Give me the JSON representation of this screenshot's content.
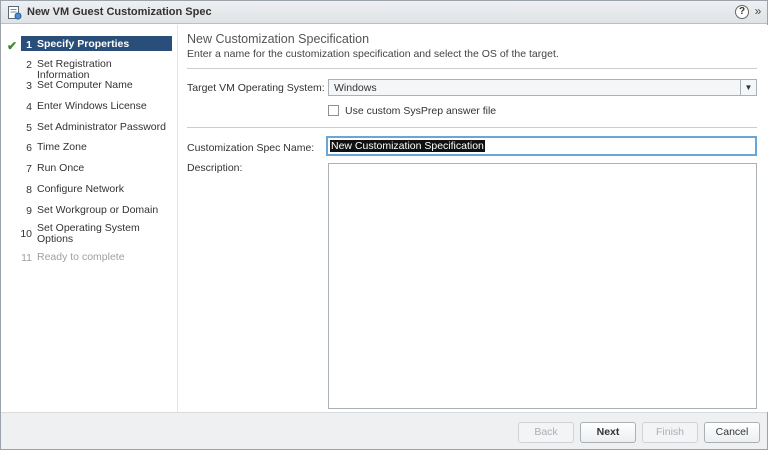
{
  "window": {
    "title": "New VM Guest Customization Spec",
    "help_label": "?",
    "close_label": "»"
  },
  "steps": [
    {
      "num": "1",
      "label": "Specify Properties",
      "state": "active",
      "check": "✔"
    },
    {
      "num": "2",
      "label": "Set Registration Information",
      "state": "normal"
    },
    {
      "num": "3",
      "label": "Set Computer Name",
      "state": "normal"
    },
    {
      "num": "4",
      "label": "Enter Windows License",
      "state": "normal"
    },
    {
      "num": "5",
      "label": "Set Administrator Password",
      "state": "normal"
    },
    {
      "num": "6",
      "label": "Time Zone",
      "state": "normal"
    },
    {
      "num": "7",
      "label": "Run Once",
      "state": "normal"
    },
    {
      "num": "8",
      "label": "Configure Network",
      "state": "normal"
    },
    {
      "num": "9",
      "label": "Set Workgroup or Domain",
      "state": "normal"
    },
    {
      "num": "10",
      "label": "Set Operating System Options",
      "state": "normal"
    },
    {
      "num": "11",
      "label": "Ready to complete",
      "state": "disabled"
    }
  ],
  "content": {
    "title": "New Customization Specification",
    "description": "Enter a name for the customization specification and select the OS of the target.",
    "target_os_label": "Target VM Operating System:",
    "target_os_value": "Windows",
    "sysprep_label": "Use custom SysPrep answer file",
    "sysprep_checked": false,
    "spec_name_label": "Customization Spec Name:",
    "spec_name_value": "New Customization Specification",
    "description_label": "Description:",
    "description_value": ""
  },
  "footer": {
    "back": "Back",
    "next": "Next",
    "finish": "Finish",
    "cancel": "Cancel"
  }
}
